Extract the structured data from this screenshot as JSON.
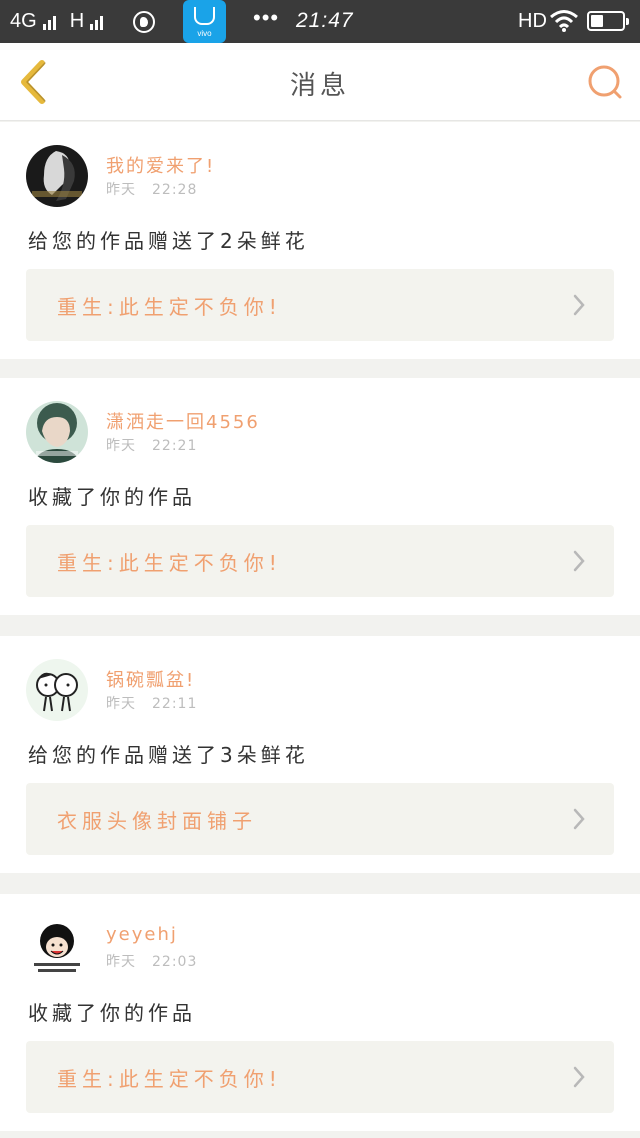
{
  "status_bar": {
    "network": "4G",
    "network2": "H",
    "time": "21:47",
    "hd": "HD",
    "app_brand": "vivo",
    "dots": "•••"
  },
  "header": {
    "title": "消息",
    "back_icon": "chevron-left-icon",
    "search_icon": "search-icon"
  },
  "colors": {
    "accent": "#f0a070",
    "back_icon": "#e6b93c",
    "status_bar": "#3a3a3a",
    "card_bg": "#ffffff",
    "link_bg": "#f3f3ee"
  },
  "messages": [
    {
      "username": "我的爱来了!",
      "day": "昨天",
      "time": "22:28",
      "action": "给您的作品赠送了2朵鲜花",
      "work_title": "重生:此生定不负你!",
      "avatar": "avatar-dark-portrait"
    },
    {
      "username": "潇洒走一回4556",
      "day": "昨天",
      "time": "22:21",
      "action": "收藏了你的作品",
      "work_title": "重生:此生定不负你!",
      "avatar": "avatar-green-portrait"
    },
    {
      "username": "锅碗瓢盆!",
      "day": "昨天",
      "time": "22:11",
      "action": "给您的作品赠送了3朵鲜花",
      "work_title": "衣服头像封面铺子",
      "avatar": "avatar-cartoon-couple"
    },
    {
      "username": "yeyehj",
      "day": "昨天",
      "time": "22:03",
      "action": "收藏了你的作品",
      "work_title": "重生:此生定不负你!",
      "avatar": "avatar-meme-face"
    }
  ]
}
